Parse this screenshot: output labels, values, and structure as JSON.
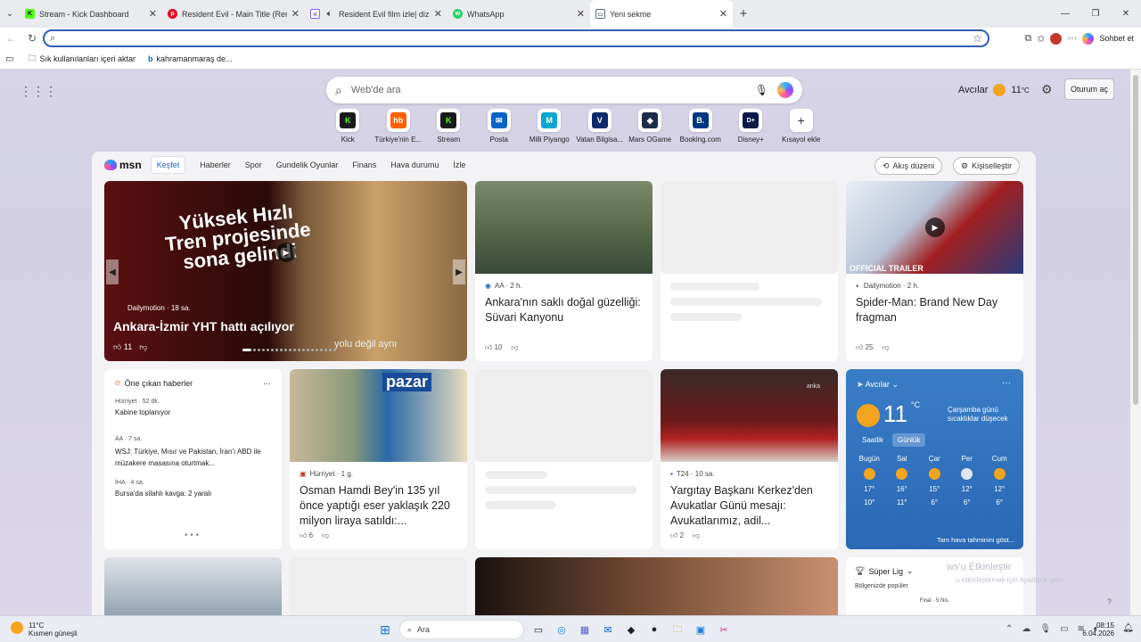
{
  "tabs": [
    {
      "title": "Stream - Kick Dashboard",
      "icon": "kick-icon",
      "color": "#53fc18"
    },
    {
      "title": "Resident Evil - Main Title (Remaste",
      "icon": "pinterest-icon",
      "color": "#e60023"
    },
    {
      "title": "Resident Evil film izle| dizipod",
      "icon": "dizipod-icon",
      "color": "#7b61ff"
    },
    {
      "title": "WhatsApp",
      "icon": "whatsapp-icon",
      "color": "#25d366"
    },
    {
      "title": "Yeni sekme",
      "icon": "newtab-icon",
      "color": "#5a6a80"
    }
  ],
  "address": {
    "value": "",
    "placeholder": ""
  },
  "toolbar": {
    "copilot_label": "Sohbet et"
  },
  "bookmarks": [
    {
      "label": "Sık kullanılanları içeri aktar"
    },
    {
      "label": "kahramanmaraş de..."
    }
  ],
  "search": {
    "placeholder": "Web'de ara"
  },
  "top_weather": {
    "location": "Avcılar",
    "temp": "11",
    "unit": "°C"
  },
  "signin": "Oturum aç",
  "shortcuts": [
    {
      "label": "Kick",
      "letter": "K",
      "color": "#1a1a1a",
      "fg": "#53fc18"
    },
    {
      "label": "Türkiye'nin E...",
      "letter": "hb",
      "color": "#ff6000",
      "fg": "#fff"
    },
    {
      "label": "Stream",
      "letter": "K",
      "color": "#1a1a1a",
      "fg": "#53fc18"
    },
    {
      "label": "Posta",
      "letter": "✉",
      "color": "#0a64c8",
      "fg": "#fff"
    },
    {
      "label": "Milli Piyango",
      "letter": "M",
      "color": "#0aa6d0",
      "fg": "#fff"
    },
    {
      "label": "Vatan Bilgisa...",
      "letter": "V",
      "color": "#0c2a6b",
      "fg": "#fff"
    },
    {
      "label": "Mars OGame",
      "letter": "◆",
      "color": "#1c2d4a",
      "fg": "#fff"
    },
    {
      "label": "Booking.com",
      "letter": "B.",
      "color": "#003580",
      "fg": "#fff"
    },
    {
      "label": "Disney+",
      "letter": "D+",
      "color": "#0a1b4a",
      "fg": "#fff"
    },
    {
      "label": "Kısayol ekle",
      "letter": "+",
      "color": "#ffffff",
      "fg": "#333"
    }
  ],
  "feed": {
    "nav": [
      "Keşfet",
      "Haberler",
      "Spor",
      "Gundelik Oyunlar",
      "Finans",
      "Hava durumu",
      "İzle"
    ],
    "layout_btn": "Akış düzeni",
    "personalize_btn": "Kişiselleştir"
  },
  "hero": {
    "overlay_title": "Yüksek Hızlı Tren projesinde sona gelindi",
    "source": "Dailymotion · 18 sa.",
    "headline": "Ankara-İzmir YHT hattı açılıyor",
    "likes": "11",
    "overlay_bottom": "yolu değil aynı"
  },
  "cards": {
    "suvari": {
      "source": "AA · 2 h.",
      "headline": "Ankara'nın saklı doğal güzelliği: Süvari Kanyonu",
      "likes": "10"
    },
    "spiderman": {
      "source": "Dailymotion · 2 h.",
      "headline": "Spider-Man: Brand New Day fragman",
      "likes": "25",
      "image_text": "OFFICIAL TRAILER"
    },
    "osman": {
      "source": "Hürriyet · 1 g.",
      "headline": "Osman Hamdi Bey'in 135 yıl önce yaptığı eser yaklaşık 220 milyon liraya satıldı:...",
      "likes": "6",
      "image_text": "pazar"
    },
    "yargitay": {
      "source": "T24 · 10 sa.",
      "headline": "Yargıtay Başkanı Kerkez'den Avukatlar Günü mesajı: Avukatlarımız, adil...",
      "likes": "2",
      "image_text": "anka"
    }
  },
  "top_news": {
    "title": "Öne çıkan haberler",
    "items": [
      {
        "source": "Hürriyet · 52 dk.",
        "text": "Kabine toplanıyor"
      },
      {
        "source": "AA · 7 sa.",
        "text": "WSJ: Türkiye, Mısır ve Pakistan, İran'ı ABD ile müzakere masasına oturtmak..."
      },
      {
        "source": "İHA · 4 sa.",
        "text": "Bursa'da silahlı kavga: 2 yaralı"
      }
    ]
  },
  "weather": {
    "location": "Avcılar",
    "temp": "11",
    "unit": "°C",
    "desc": "Çarşamba günü sıcaklıklar düşecek",
    "tabs": [
      "Saatlik",
      "Günlük"
    ],
    "days": [
      {
        "name": "Bugün",
        "hi": "17°",
        "lo": "10°",
        "icon": "sun-icon"
      },
      {
        "name": "Sal",
        "hi": "16°",
        "lo": "11°",
        "icon": "partly-sunny-icon"
      },
      {
        "name": "Çar",
        "hi": "15°",
        "lo": "6°",
        "icon": "partly-sunny-icon"
      },
      {
        "name": "Per",
        "hi": "12°",
        "lo": "6°",
        "icon": "cloud-icon"
      },
      {
        "name": "Cum",
        "hi": "12°",
        "lo": "6°",
        "icon": "partly-sunny-icon"
      }
    ],
    "more": "Tam hava tahminini göst..."
  },
  "league": {
    "title": "Süper Lig",
    "sub": "Bölgenizde popüler",
    "score": "Final · 5 Nis."
  },
  "windows_watermark": {
    "line1": "ws'u Etkinleştir",
    "line2": "u etkinleştirmek için Ayarlar'a gidin."
  },
  "taskbar": {
    "weather_temp": "11°C",
    "weather_desc": "Kısmen güneşli",
    "search": "Ara",
    "time": "08:15",
    "date": "6.04.2026"
  }
}
